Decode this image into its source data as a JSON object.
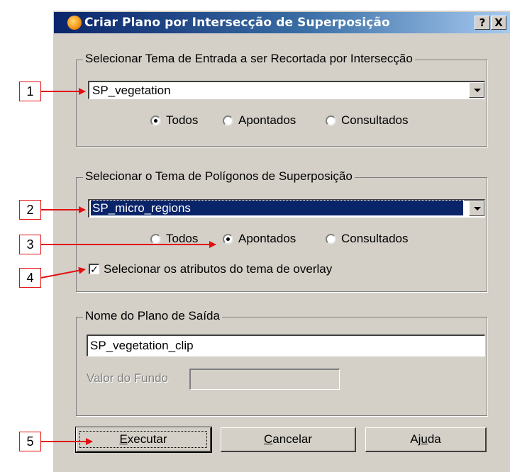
{
  "window": {
    "title": "Criar Plano por Intersecção de Superposição",
    "help_btn": "?",
    "close_btn": "X"
  },
  "input_group": {
    "legend": "Selecionar Tema de Entrada a ser Recortada por Intersecção",
    "selected": "SP_vegetation",
    "radios": [
      "Todos",
      "Apontados",
      "Consultados"
    ],
    "checked": "Todos"
  },
  "overlay_group": {
    "legend": "Selecionar o Tema de Polígonos de Superposição",
    "selected": "SP_micro_regions",
    "radios": [
      "Todos",
      "Apontados",
      "Consultados"
    ],
    "checked": "Apontados",
    "checkbox_label": "Selecionar os atributos do tema de overlay",
    "checkbox_checked": true
  },
  "output_group": {
    "legend": "Nome do Plano de Saída",
    "name_value": "SP_vegetation_clip",
    "background_label": "Valor do Fundo",
    "background_value": ""
  },
  "buttons": {
    "execute": {
      "pre": "",
      "acc": "E",
      "post": "xecutar"
    },
    "cancel": {
      "pre": "",
      "acc": "C",
      "post": "ancelar"
    },
    "help": {
      "pre": "Aj",
      "acc": "u",
      "post": "da"
    }
  },
  "callouts": [
    "1",
    "2",
    "3",
    "4",
    "5"
  ],
  "colors": {
    "title_start": "#0a246a",
    "title_end": "#a6caf0",
    "dialog_bg": "#d4d0c8",
    "callout_red": "#e01010"
  }
}
